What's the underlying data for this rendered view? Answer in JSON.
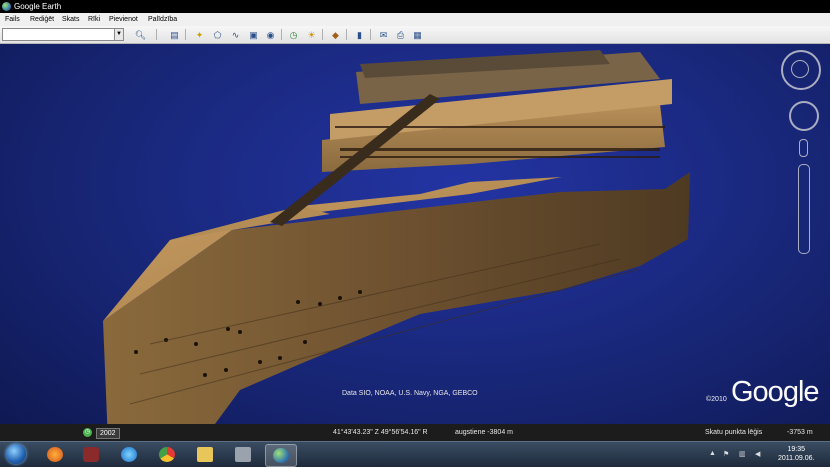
{
  "window": {
    "title": "Google Earth"
  },
  "menu": [
    "Fails",
    "Rediģēt",
    "Skats",
    "Rīki",
    "Pievienot",
    "Palīdzība"
  ],
  "toolbar": {
    "search_value": "",
    "icons": [
      "search-icon",
      "sidebar-icon",
      "placemark-icon",
      "polygon-icon",
      "path-icon",
      "overlay-icon",
      "tour-icon",
      "historical-imagery-icon",
      "sunlight-icon",
      "sky-icon",
      "ruler-icon",
      "email-icon",
      "print-icon",
      "maps-icon"
    ]
  },
  "viewport": {
    "attribution": "Data SIO, NOAA, U.S. Navy, NGA, GEBCO",
    "copyright": "©2010",
    "logo": "Google"
  },
  "status": {
    "year": "2002",
    "coords": "41°43'43.23\" Z  49°56'54.16\" R",
    "elevation": "augstiene -3804 m",
    "eye_alt_label": "Skatu punkta lēģis",
    "eye_alt_value": "-3753 m"
  },
  "taskbar": {
    "apps": [
      "firefox",
      "other-app",
      "internet-explorer",
      "chrome",
      "folder",
      "tool",
      "google-earth"
    ],
    "time": "19:35",
    "date": "2011.09.06."
  }
}
